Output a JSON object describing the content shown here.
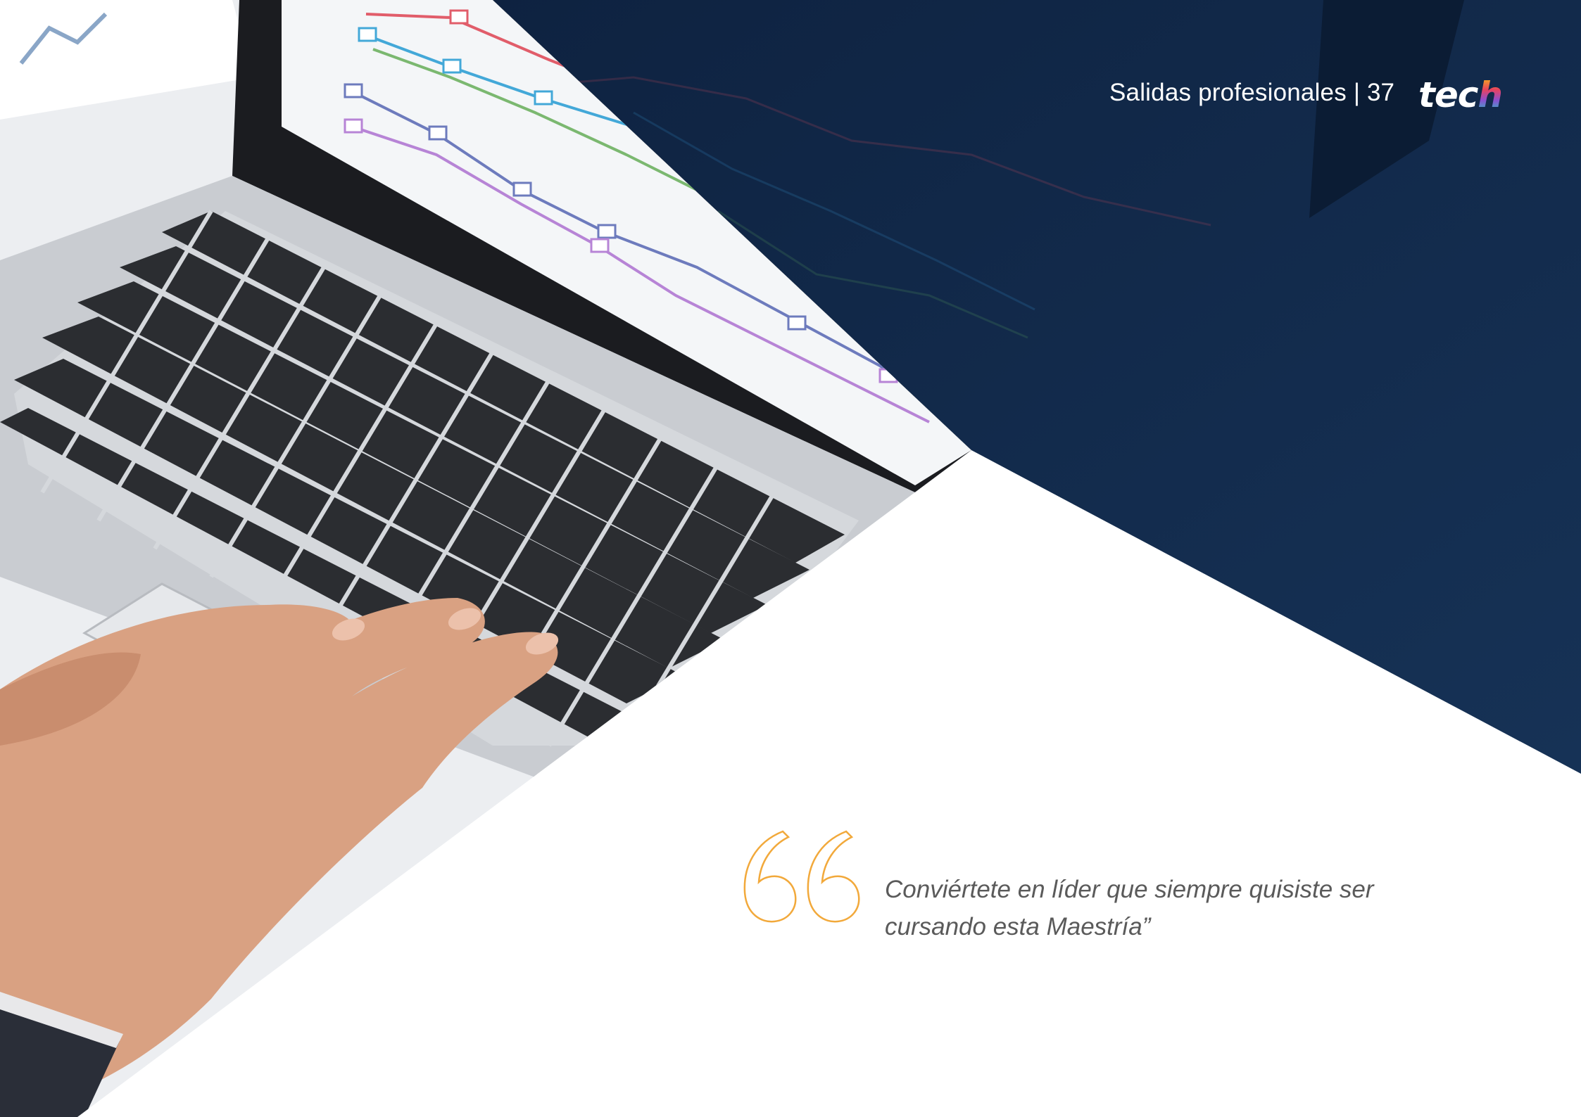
{
  "header": {
    "section_title": "Salidas profesionales",
    "separator": "|",
    "page_number": "37",
    "logo_text_main": "tec",
    "logo_text_end": "h"
  },
  "quote": {
    "line1": "Conviértete en líder que siempre quisiste ser",
    "line2": "cursando esta Maestría”"
  },
  "colors": {
    "navy": "#163256",
    "navy_dark": "#0e2240",
    "quote_mark": "#f2a93b",
    "quote_text": "#5a5a5a",
    "header_text": "#ffffff",
    "screen_white": "#f4f6f8",
    "laptop_silver": "#c9ccd1",
    "key_dark": "#2b2d31",
    "skin": "#d9a182",
    "sleeve": "#2a2e38"
  },
  "photo": {
    "icon": "laptop-photo"
  }
}
